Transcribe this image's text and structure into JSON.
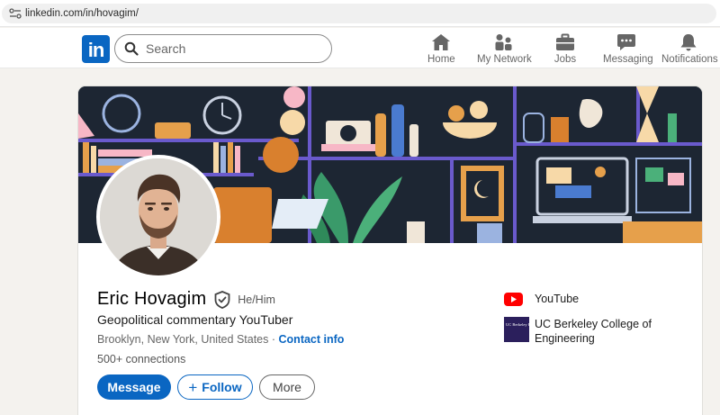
{
  "browser": {
    "url": "linkedin.com/in/hovagim/"
  },
  "nav": {
    "logo": "in",
    "search_placeholder": "Search",
    "items": [
      {
        "label": "Home",
        "icon": "home-icon"
      },
      {
        "label": "My Network",
        "icon": "network-icon"
      },
      {
        "label": "Jobs",
        "icon": "briefcase-icon"
      },
      {
        "label": "Messaging",
        "icon": "chat-icon"
      },
      {
        "label": "Notifications",
        "icon": "bell-icon"
      }
    ]
  },
  "profile": {
    "name": "Eric Hovagim",
    "pronouns": "He/Him",
    "headline": "Geopolitical commentary YouTuber",
    "location": "Brooklyn, New York, United States",
    "location_separator": "·",
    "contact_info": "Contact info",
    "connections": "500+ connections",
    "buttons": {
      "message": "Message",
      "follow": "Follow",
      "more": "More"
    },
    "affiliations": [
      {
        "label": "YouTube",
        "icon": "youtube-icon"
      },
      {
        "label": "UC Berkeley College of Engineering",
        "icon": "uc-berkeley-logo",
        "logo_text": "UC Berkeley Engineering"
      }
    ]
  },
  "colors": {
    "brand": "#0a66c2",
    "page_background": "#f4f2ee",
    "banner_background": "#1d2633",
    "youtube_red": "#ff0000",
    "berkeley_navy": "#2b1f5c"
  }
}
